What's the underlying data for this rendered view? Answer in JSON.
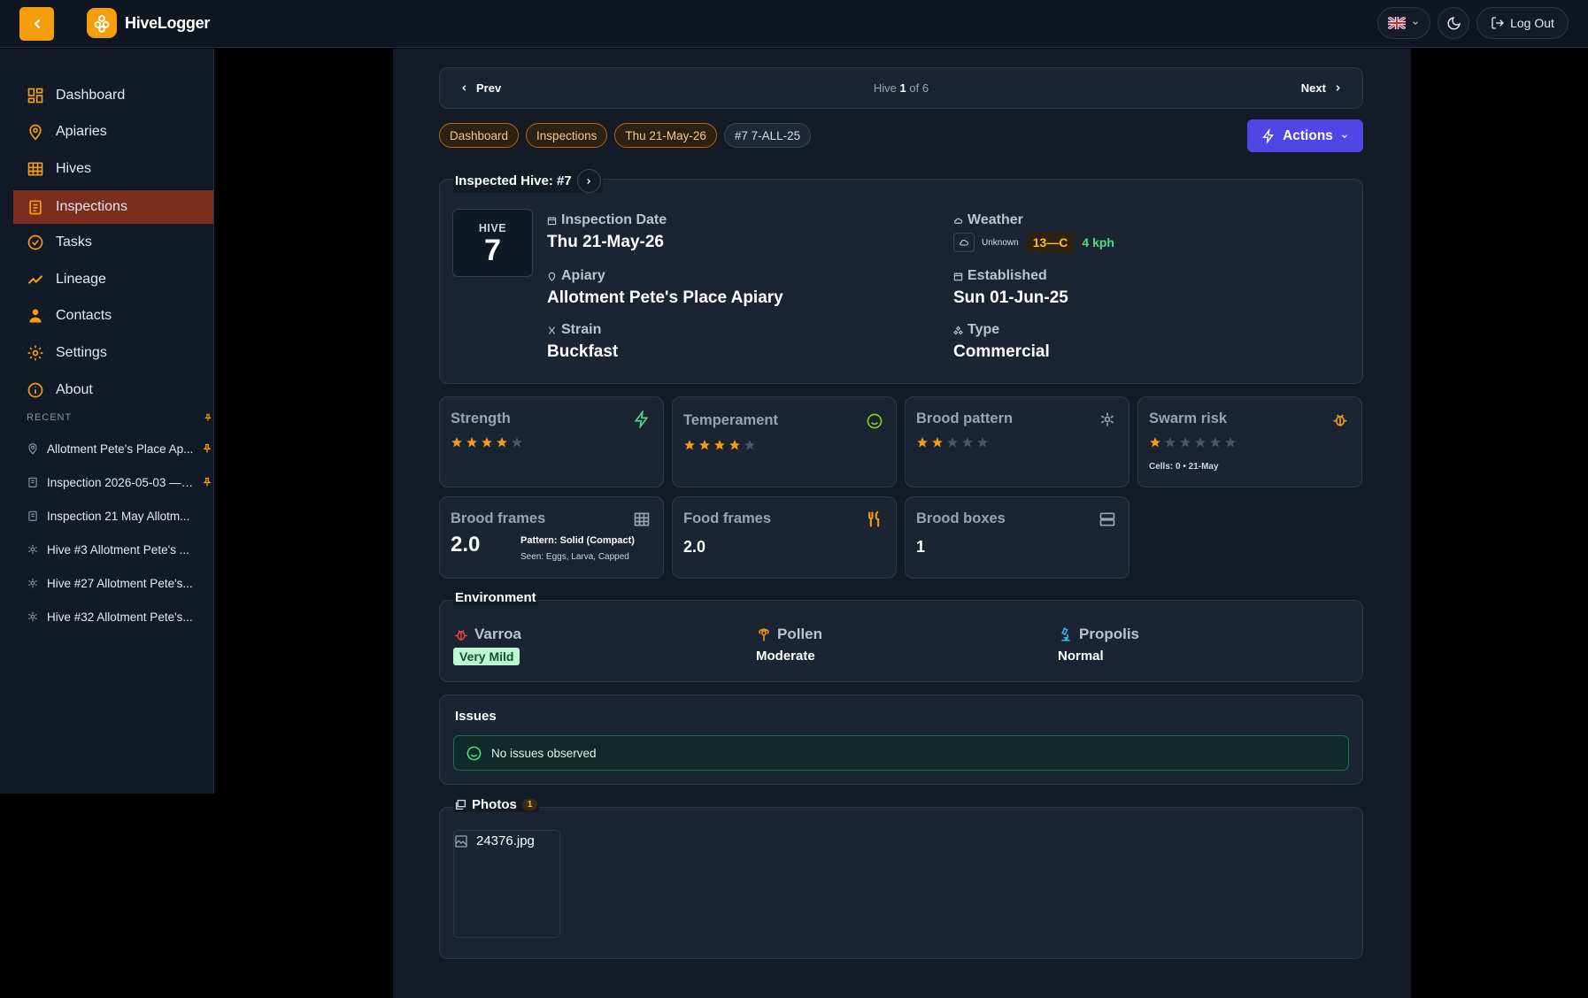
{
  "app": {
    "name": "HiveLogger"
  },
  "header": {
    "logout_label": "Log Out"
  },
  "sidebar": {
    "items": [
      {
        "label": "Dashboard"
      },
      {
        "label": "Apiaries"
      },
      {
        "label": "Hives"
      },
      {
        "label": "Inspections"
      },
      {
        "label": "Tasks"
      },
      {
        "label": "Lineage"
      },
      {
        "label": "Contacts"
      },
      {
        "label": "Settings"
      },
      {
        "label": "About"
      }
    ],
    "recent_heading": "RECENT",
    "recent": [
      {
        "label": "Allotment Pete's Place Ap..."
      },
      {
        "label": "Inspection 2026-05-03 — ..."
      },
      {
        "label": "Inspection 21 May Allotm..."
      },
      {
        "label": "Hive #3 Allotment Pete's ..."
      },
      {
        "label": "Hive #27 Allotment Pete's..."
      },
      {
        "label": "Hive #32 Allotment Pete's..."
      }
    ]
  },
  "pager": {
    "prev": "Prev",
    "next": "Next",
    "prefix": "Hive",
    "current": "1",
    "of": "of 6"
  },
  "breadcrumbs": [
    "Dashboard",
    "Inspections",
    "Thu 21-May-26",
    "#7 7-ALL-25"
  ],
  "actions_label": "Actions",
  "inspected": {
    "title": "Inspected Hive: #7",
    "hive_label": "HIVE",
    "hive_number": "7",
    "inspection_date_label": "Inspection Date",
    "inspection_date": "Thu 21-May-26",
    "apiary_label": "Apiary",
    "apiary": "Allotment Pete's Place Apiary",
    "strain_label": "Strain",
    "strain": "Buckfast",
    "weather_label": "Weather",
    "weather_condition": "Unknown",
    "temperature": "13—C",
    "wind": "4 kph",
    "established_label": "Established",
    "established": "Sun 01-Jun-25",
    "type_label": "Type",
    "type": "Commercial"
  },
  "metrics": {
    "strength": {
      "label": "Strength",
      "rating": 4,
      "max": 5
    },
    "temperament": {
      "label": "Temperament",
      "rating": 4,
      "max": 5
    },
    "brood_pattern": {
      "label": "Brood pattern",
      "rating": 2,
      "max": 5
    },
    "swarm_risk": {
      "label": "Swarm risk",
      "rating": 1,
      "max": 6,
      "note": "Cells: 0 • 21-May"
    },
    "brood_frames": {
      "label": "Brood frames",
      "value": "2.0",
      "pattern": "Pattern: Solid (Compact)",
      "seen": "Seen: Eggs, Larva, Capped"
    },
    "food_frames": {
      "label": "Food frames",
      "value": "2.0"
    },
    "brood_boxes": {
      "label": "Brood boxes",
      "value": "1"
    }
  },
  "environment": {
    "title": "Environment",
    "varroa_label": "Varroa",
    "varroa": "Very Mild",
    "pollen_label": "Pollen",
    "pollen": "Moderate",
    "propolis_label": "Propolis",
    "propolis": "Normal"
  },
  "issues": {
    "title": "Issues",
    "status": "No issues observed"
  },
  "photos": {
    "title": "Photos",
    "count": "1",
    "file": "24376.jpg"
  },
  "colors": {
    "accent": "#f59e0b",
    "primary": "#4f46e5",
    "success": "#4ade80",
    "danger": "#ef4444"
  }
}
